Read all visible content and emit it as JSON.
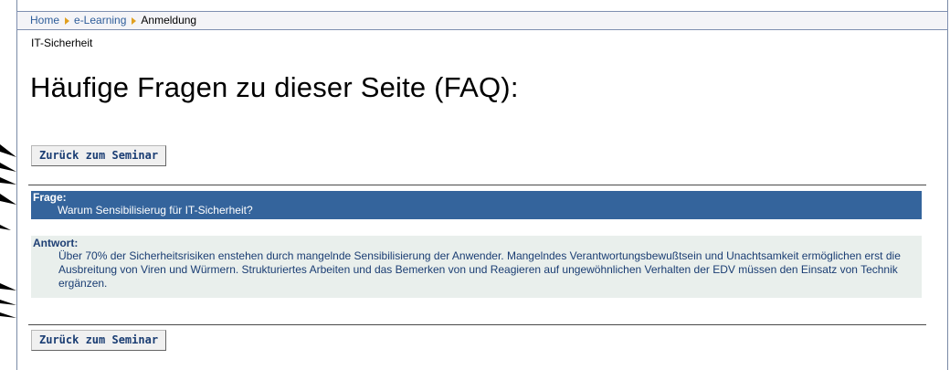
{
  "breadcrumb": {
    "home": "Home",
    "elearning": "e-Learning",
    "current": "Anmeldung"
  },
  "section_label": "IT-Sicherheit",
  "page_title": "Häufige Fragen zu dieser Seite (FAQ):",
  "buttons": {
    "back_top": "Zurück zum Seminar",
    "back_bottom": "Zurück zum Seminar"
  },
  "faq": {
    "question_label": "Frage:",
    "question": "Warum Sensibilisierug für IT-Sicherheit?",
    "answer_label": "Antwort:",
    "answer": "Über 70% der Sicherheitsrisiken enstehen durch mangelnde Sensibilisierung der Anwender. Mangelndes Verantwortungsbewußtsein und Unachtsamkeit ermöglichen erst die Ausbreitung von Viren und Würmern. Strukturiertes Arbeiten und das Bemerken von und Reagieren auf ungewöhnlichen Verhalten der EDV müssen den Einsatz von Technik ergänzen."
  },
  "colors": {
    "question_bg": "#34649c",
    "answer_bg": "#e9efec",
    "link": "#2e5d9a",
    "arrow": "#e0a020"
  }
}
